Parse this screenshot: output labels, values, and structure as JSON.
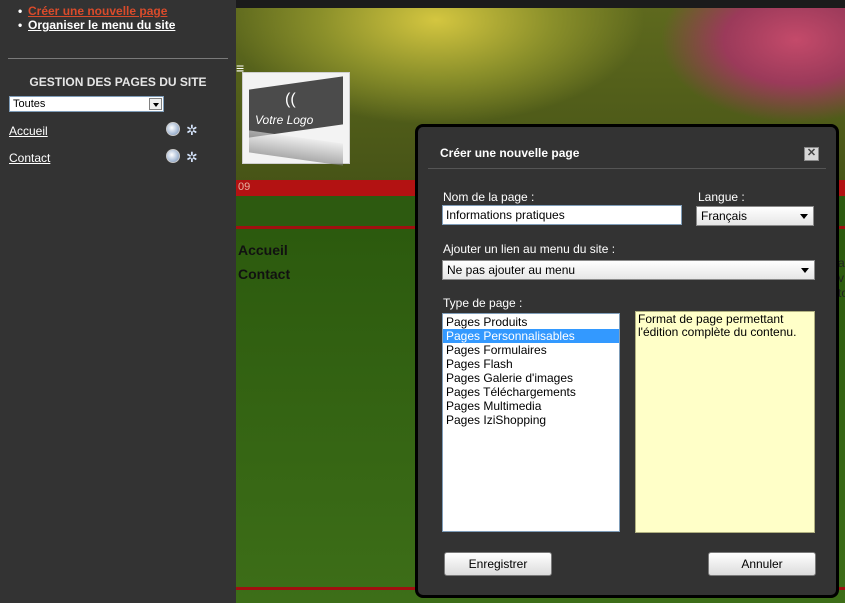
{
  "sidebar": {
    "create_page_link": "Créer une nouvelle page",
    "organize_menu_link": "Organiser le menu du site",
    "section_title": "GESTION DES PAGES DU SITE",
    "filter_value": "Toutes",
    "pages": [
      {
        "label": "Accueil",
        "icons": [
          "edit-icon",
          "settings-icon"
        ]
      },
      {
        "label": "Contact",
        "icons": [
          "edit-icon",
          "settings-icon"
        ]
      }
    ]
  },
  "preview": {
    "logo_text": "Votre Logo",
    "red_bar_text": "09",
    "nav": [
      "Accueil",
      "Contact"
    ],
    "right_letters": [
      "a",
      "v",
      "to"
    ]
  },
  "dialog": {
    "title": "Créer une nouvelle page",
    "close_symbol": "✕",
    "name_label": "Nom de la page :",
    "name_value": "Informations pratiques",
    "language_label": "Langue :",
    "language_value": "Français",
    "menu_label": "Ajouter un lien au menu du site :",
    "menu_value": "Ne pas ajouter au menu",
    "type_label": "Type de page :",
    "page_types": [
      "Pages Produits",
      "Pages Personnalisables",
      "Pages Formulaires",
      "Pages Flash",
      "Pages Galerie d'images",
      "Pages Téléchargements",
      "Pages Multimedia",
      "Pages IziShopping"
    ],
    "selected_type": "Pages Personnalisables",
    "type_description": "Format de page permettant l'édition complète du contenu.",
    "save_button": "Enregistrer",
    "cancel_button": "Annuler"
  }
}
